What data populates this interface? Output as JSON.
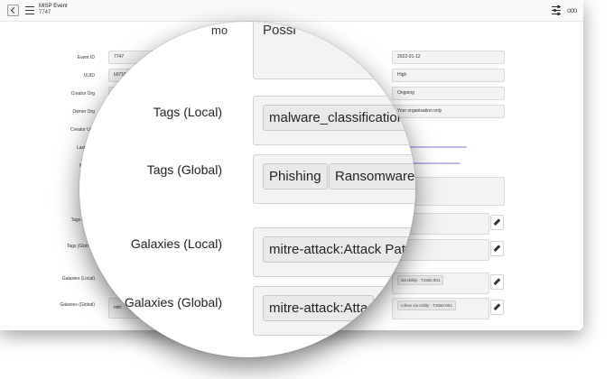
{
  "window": {
    "title": "MISP Event",
    "subtitle": "7747"
  },
  "form": {
    "event_id_label": "Event ID",
    "event_id_value": "7747",
    "uuid_label": "UUID",
    "uuid_value": "b0715",
    "creator_org_label": "Creator Org",
    "owner_org_label": "Owner Org",
    "creator_user_label": "Creator Use",
    "last_change_label": "Last Cha",
    "misp_s_label": "MISP S",
    "tags_local_label": "Tags (L",
    "tags_global_label": "Tags (Glob",
    "galaxies_local_label": "Galaxies (Local)",
    "galaxies_global_label": "Galaxies (Global)",
    "galaxies_global_value": "mitr",
    "date_label": "d date (in MISP)",
    "date_value": "2022-01-12",
    "threat_label": "t Level",
    "threat_value": "High",
    "analysis_value": "Ongoing",
    "distribution_value": "Your organisation only",
    "galaxy_local_pill": "via Utility - T1560.001",
    "galaxy_global_pill": "rchive via Utility - T1560.001"
  },
  "magnifier": {
    "top_label_fragment": "mo",
    "top_value_fragment": "Possi",
    "tags_local_label": "Tags (Local)",
    "tags_local_value": "malware_classification",
    "tags_global_label": "Tags (Global)",
    "tags_global_values": [
      "Phishing",
      "Ransomware"
    ],
    "galaxies_local_label": "Galaxies (Local)",
    "galaxies_local_value": "mitre-attack:Attack Patte",
    "galaxies_global_label": "Galaxies (Global)",
    "galaxies_global_value": "mitre-attack:Atta"
  },
  "colors": {
    "field_bg": "#f3f3f3",
    "link": "#b8b8ec",
    "icon": "#333333"
  }
}
